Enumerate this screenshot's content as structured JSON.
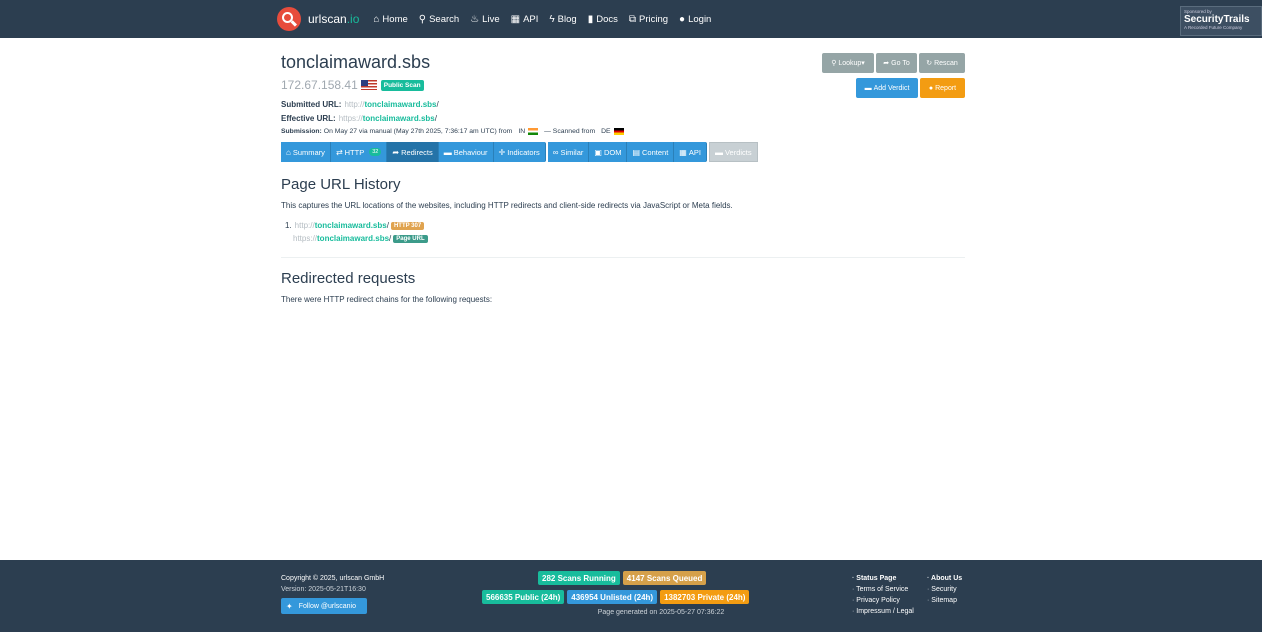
{
  "brand": {
    "name": "urlscan",
    "tld": ".io"
  },
  "nav": {
    "home": "Home",
    "search": "Search",
    "live": "Live",
    "api": "API",
    "blog": "Blog",
    "docs": "Docs",
    "pricing": "Pricing",
    "login": "Login"
  },
  "sponsor": {
    "line1": "Sponsored by",
    "name": "SecurityTrails",
    "line3": "A Recorded Future Company"
  },
  "scan": {
    "domain": "tonclaimaward.sbs",
    "ip": "172.67.158.41",
    "visibility": "Public Scan",
    "submitted_label": "Submitted URL:",
    "submitted_scheme": "http://",
    "submitted_host": "tonclaimaward.sbs",
    "submitted_path": "/",
    "effective_label": "Effective URL:",
    "effective_scheme": "https://",
    "effective_host": "tonclaimaward.sbs",
    "effective_path": "/",
    "submission_label": "Submission:",
    "submission_text": "On May 27 via manual (May 27th 2025, 7:36:17 am UTC) from",
    "submission_country": "IN",
    "scanned_from_text": "— Scanned from",
    "scanned_country": "DE"
  },
  "actions": {
    "lookup": "Lookup",
    "goto": "Go To",
    "rescan": "Rescan",
    "add_verdict": "Add Verdict",
    "report": "Report"
  },
  "tabs": {
    "summary": "Summary",
    "http": "HTTP",
    "http_count": "32",
    "redirects": "Redirects",
    "behaviour": "Behaviour",
    "indicators": "Indicators",
    "similar": "Similar",
    "dom": "DOM",
    "content": "Content",
    "api": "API",
    "verdicts": "Verdicts"
  },
  "history": {
    "title": "Page URL History",
    "description": "This captures the URL locations of the websites, including HTTP redirects and client-side redirects via JavaScript or Meta fields.",
    "item_number": "1.",
    "row1_scheme": "http://",
    "row1_host": "tonclaimaward.sbs",
    "row1_path": "/",
    "row1_label": "HTTP 307",
    "row2_scheme": "https://",
    "row2_host": "tonclaimaward.sbs",
    "row2_path": "/",
    "row2_label": "Page URL"
  },
  "redirected": {
    "title": "Redirected requests",
    "description": "There were HTTP redirect chains for the following requests:"
  },
  "footer": {
    "copyright": "Copyright © 2025, urlscan GmbH",
    "version": "Version: 2025-05-21T16:30",
    "twitter": "Follow @urlscanio",
    "scans_running": "282 Scans Running",
    "scans_queued": "4147 Scans Queued",
    "public_24h": "566635 Public (24h)",
    "unlisted_24h": "436954 Unlisted (24h)",
    "private_24h": "1382703 Private (24h)",
    "generated": "Page generated on 2025-05-27 07:36:22",
    "links_col1": [
      "Status Page",
      "Terms of Service",
      "Privacy Policy",
      "Impressum / Legal"
    ],
    "links_col2": [
      "About Us",
      "Security",
      "Sitemap"
    ]
  },
  "colors": {
    "navbar": "#2c3e50",
    "accent_green": "#18bc9c",
    "primary_blue": "#3498db",
    "warning_orange": "#f39c12",
    "brand_red": "#e74c3c"
  }
}
